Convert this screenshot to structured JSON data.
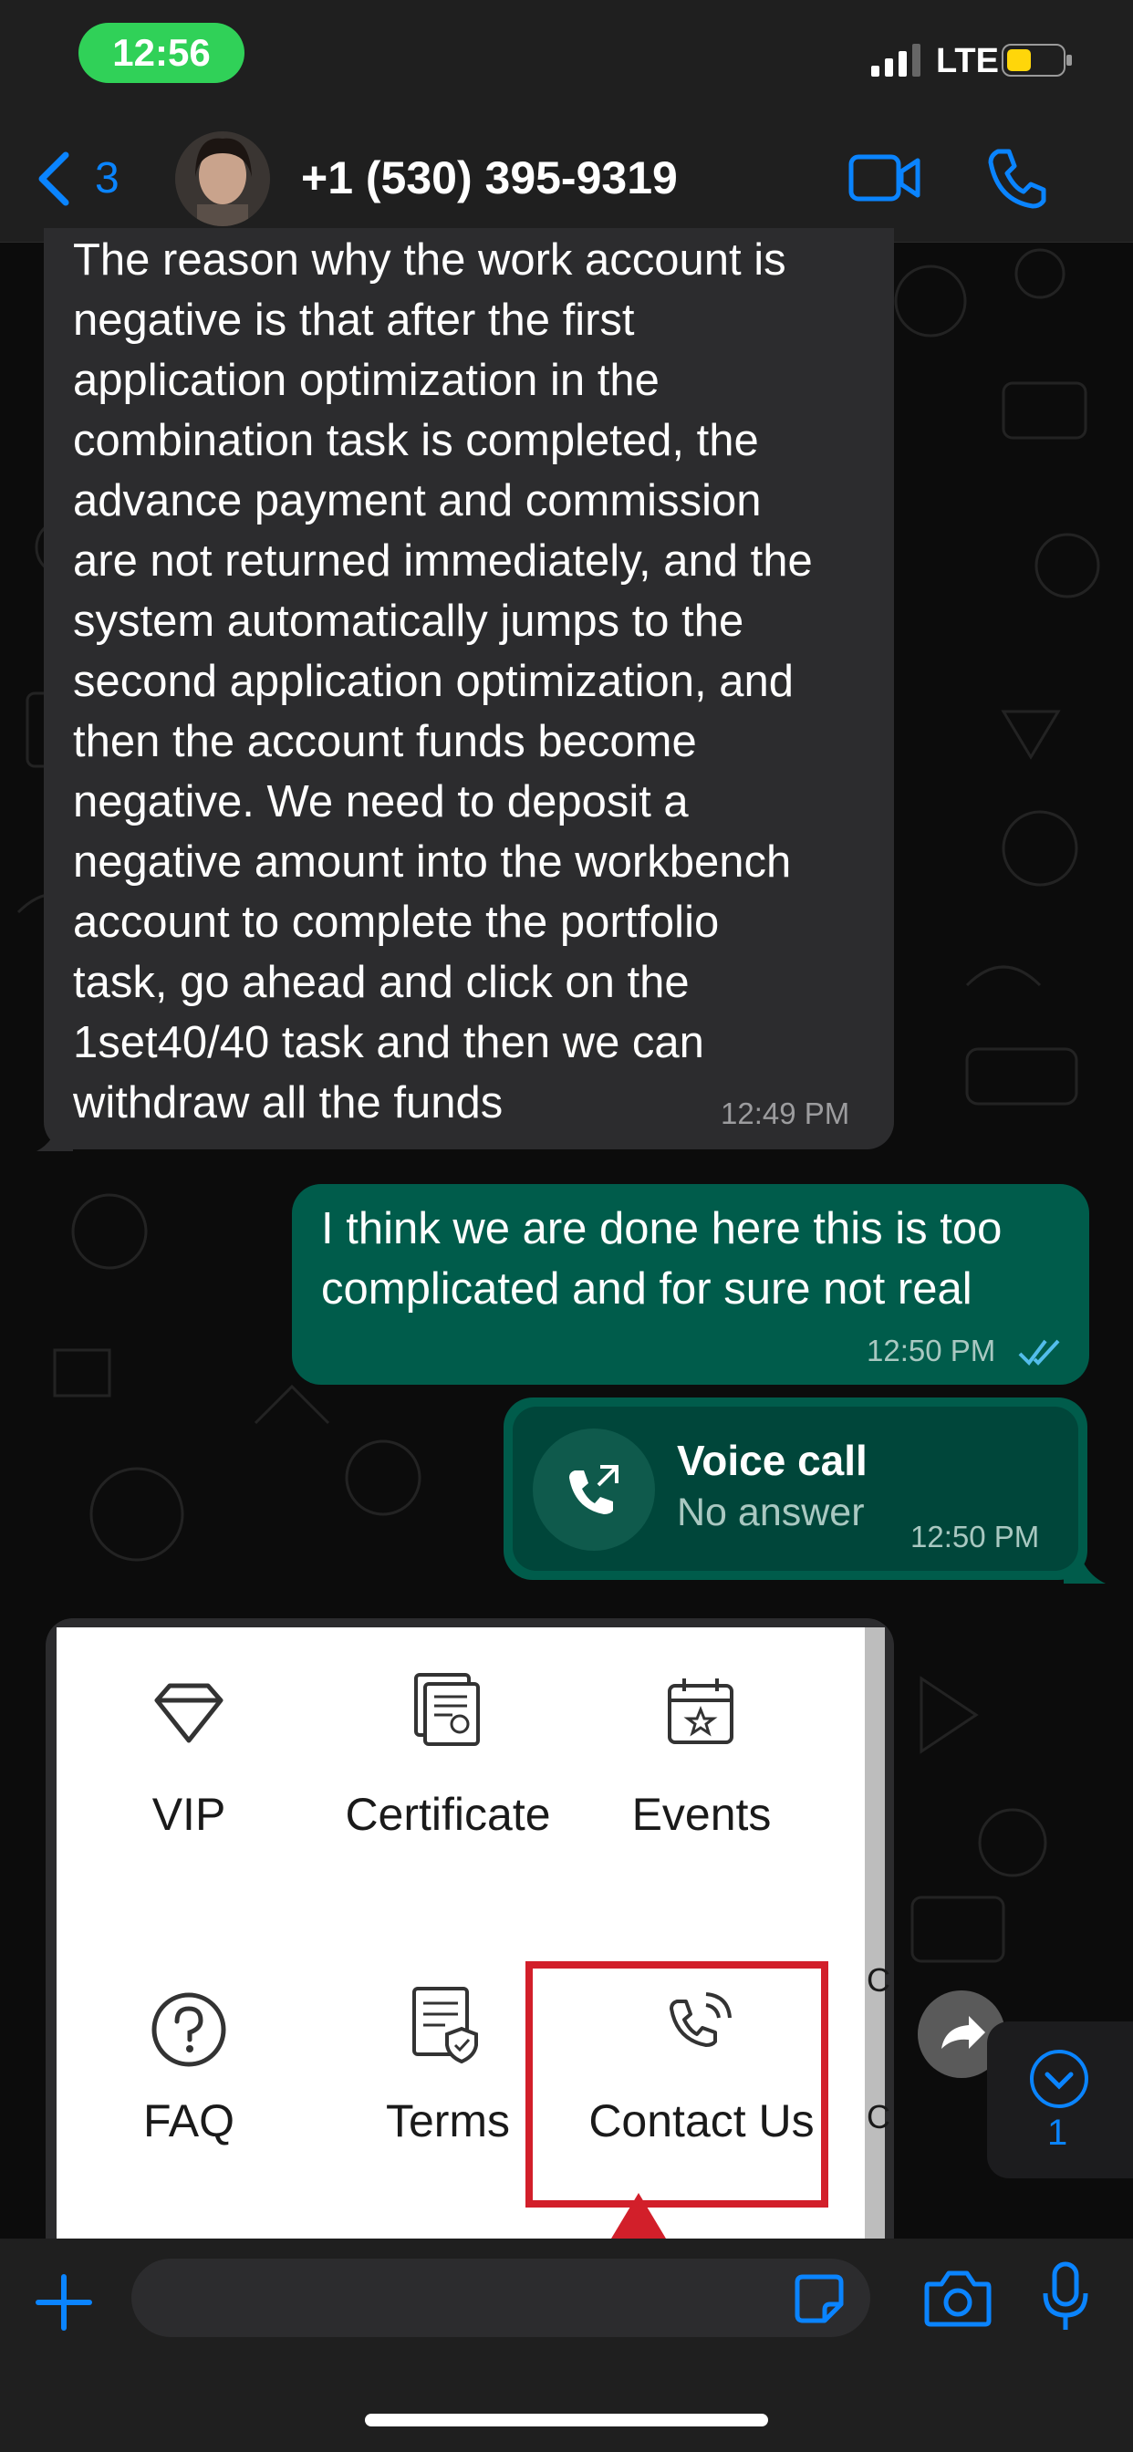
{
  "status_bar": {
    "time": "12:56",
    "network": "LTE"
  },
  "header": {
    "back_count": "3",
    "contact_name": "+1 (530) 395-9319",
    "icons": [
      "back-chevron-icon",
      "avatar",
      "video-call-icon",
      "phone-icon"
    ]
  },
  "messages": [
    {
      "direction": "incoming",
      "text": "The reason why the work account is\nnegative is that after the first\napplication optimization in the\ncombination task is completed, the\nadvance payment and commission\nare not returned immediately, and the\nsystem automatically jumps to the\nsecond application optimization, and\nthen the account funds become\nnegative. We need to deposit a\nnegative amount into the workbench\naccount to complete the portfolio\ntask, go ahead and click on the\n1set40/40 task and then we can\nwithdraw all the funds",
      "time": "12:49 PM"
    },
    {
      "direction": "outgoing",
      "text": "I think we are done here this is too\ncomplicated and for sure not real",
      "time": "12:50 PM",
      "status": "read"
    },
    {
      "direction": "outgoing",
      "type": "call",
      "title": "Voice call",
      "subtitle": "No answer",
      "time": "12:50 PM"
    }
  ],
  "image_message": {
    "tiles": [
      {
        "label": "VIP",
        "icon": "diamond-icon"
      },
      {
        "label": "Certificate",
        "icon": "certificate-icon"
      },
      {
        "label": "Events",
        "icon": "calendar-star-icon"
      },
      {
        "label": "FAQ",
        "icon": "question-icon"
      },
      {
        "label": "Terms",
        "icon": "document-shield-icon"
      },
      {
        "label": "Contact Us",
        "icon": "phone-ring-icon",
        "highlighted": true
      }
    ],
    "crop_edge_1": "C",
    "crop_edge_2": "C"
  },
  "scroll_down": {
    "unread": "1"
  },
  "input_bar": {
    "placeholder": ""
  },
  "colors": {
    "accent": "#0a84ff",
    "outgoing_bubble": "#005c4b",
    "incoming_bubble": "#2c2c2e",
    "highlight_box": "#d21f2a",
    "time_pill": "#30d158"
  }
}
